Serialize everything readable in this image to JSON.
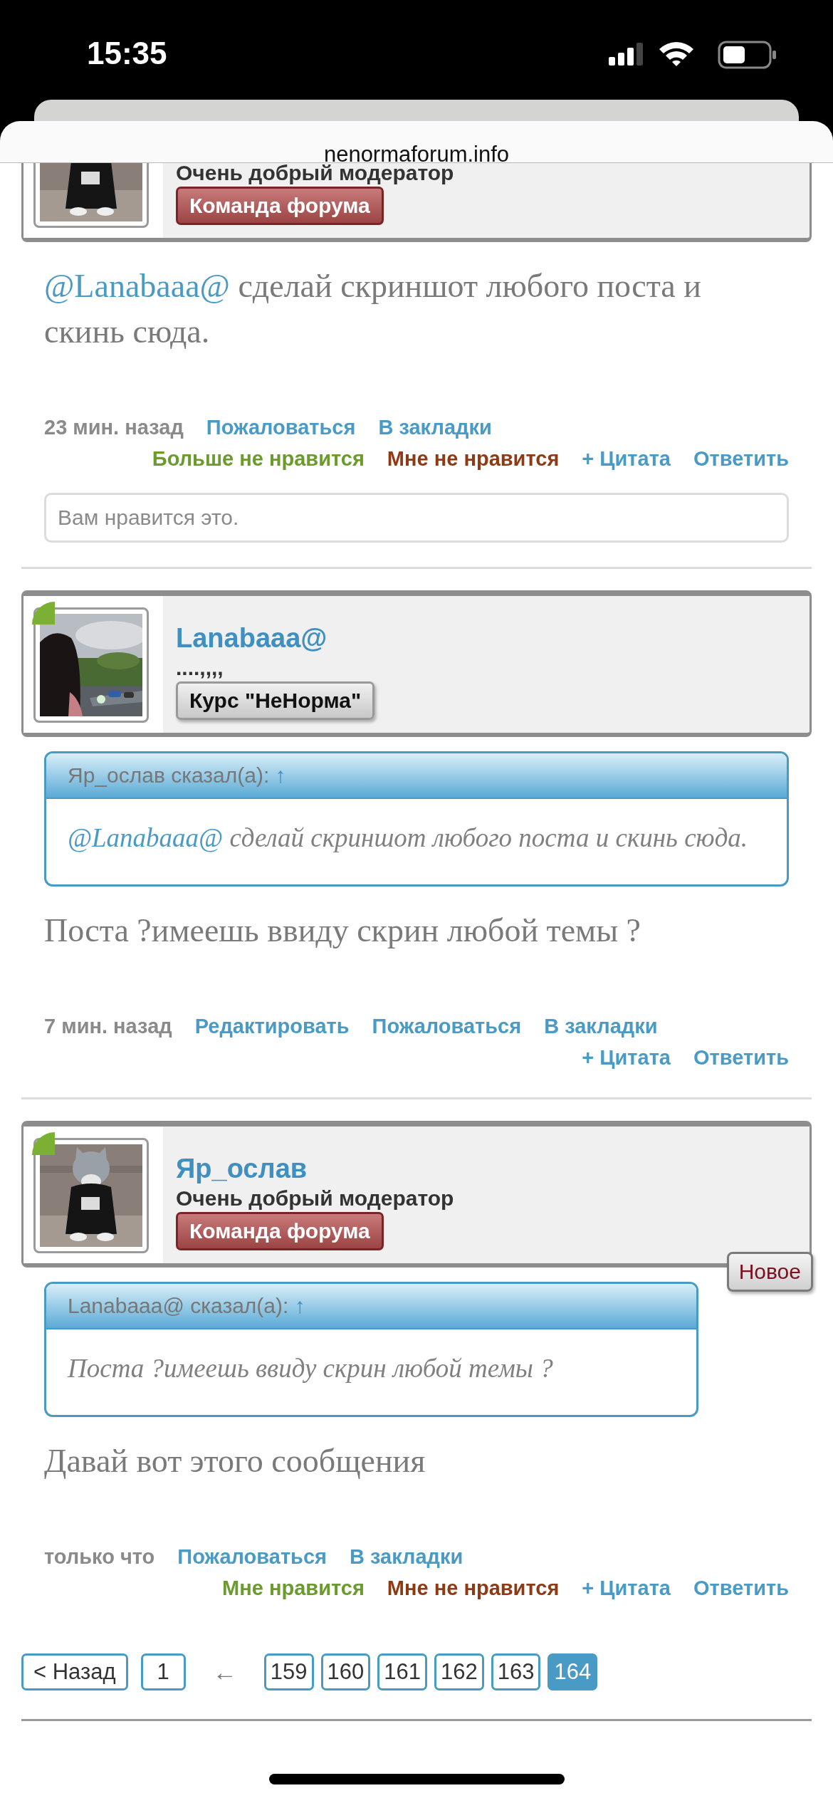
{
  "status_bar": {
    "time": "15:35"
  },
  "browser": {
    "url": "nenormaforum.info"
  },
  "posts": [
    {
      "user": {
        "title": "Очень добрый модератор",
        "badge": {
          "text": "Команда форума",
          "kind": "team"
        }
      },
      "avatar": {
        "kind": "picture"
      },
      "message": [
        {
          "kind": "mention",
          "text": "@Lanabaaa@"
        },
        {
          "kind": "text",
          "text": " сделай скриншот любого поста и скинь сюда."
        }
      ],
      "time": "23 мин. назад",
      "links": [
        "Пожаловаться",
        "В закладки"
      ],
      "actions": [
        {
          "kind": "unlike",
          "text": "Больше не нравится"
        },
        {
          "kind": "dislike",
          "text": "Мне не нравится"
        },
        {
          "kind": "link",
          "text": "+ Цитата"
        },
        {
          "kind": "link",
          "text": "Ответить"
        }
      ],
      "likes_summary": "Вам нравится это."
    },
    {
      "user": {
        "name": "Lanabaaa@",
        "title": "....,,,,",
        "badge": {
          "text": "Курс \"НеНорма\"",
          "kind": "course"
        }
      },
      "avatar": {
        "kind": "picture"
      },
      "online": true,
      "quote": {
        "author": "Яр_ослав сказал(а):",
        "arrow": "↑",
        "message": [
          {
            "kind": "mention",
            "text": "@Lanabaaa@"
          },
          {
            "kind": "text",
            "text": " сделай скриншот любого поста и скинь сюда."
          }
        ]
      },
      "message": [
        {
          "kind": "text",
          "text": "Поста ?имеешь ввиду скрин любой темы ?"
        }
      ],
      "time": "7 мин. назад",
      "links": [
        "Редактировать",
        "Пожаловаться",
        "В закладки"
      ],
      "actions": [
        {
          "kind": "link",
          "text": "+ Цитата"
        },
        {
          "kind": "link",
          "text": "Ответить"
        }
      ]
    },
    {
      "user": {
        "name": "Яр_ослав",
        "title": "Очень добрый модератор",
        "badge": {
          "text": "Команда форума",
          "kind": "team"
        }
      },
      "avatar": {
        "kind": "picture"
      },
      "online": true,
      "new_label": "Новое",
      "quote": {
        "author": "Lanabaaa@ сказал(а):",
        "arrow": "↑",
        "message": [
          {
            "kind": "text",
            "text": "Поста ?имеешь ввиду скрин любой темы ?"
          }
        ]
      },
      "message": [
        {
          "kind": "text",
          "text": "Давай вот этого сообщения"
        }
      ],
      "time": "только что",
      "links": [
        "Пожаловаться",
        "В закладки"
      ],
      "actions": [
        {
          "kind": "like",
          "text": "Мне нравится"
        },
        {
          "kind": "dislike",
          "text": "Мне не нравится"
        },
        {
          "kind": "link",
          "text": "+ Цитата"
        },
        {
          "kind": "link",
          "text": "Ответить"
        }
      ]
    }
  ],
  "pagination": [
    {
      "kind": "prev",
      "text": "< Назад"
    },
    {
      "kind": "page",
      "text": "1",
      "selected": false
    },
    {
      "kind": "gap",
      "text": "←"
    },
    {
      "kind": "page",
      "text": "159",
      "selected": false
    },
    {
      "kind": "page",
      "text": "160",
      "selected": false
    },
    {
      "kind": "page",
      "text": "161",
      "selected": false
    },
    {
      "kind": "page",
      "text": "162",
      "selected": false
    },
    {
      "kind": "page",
      "text": "163",
      "selected": false
    },
    {
      "kind": "page",
      "text": "164",
      "selected": true
    }
  ]
}
